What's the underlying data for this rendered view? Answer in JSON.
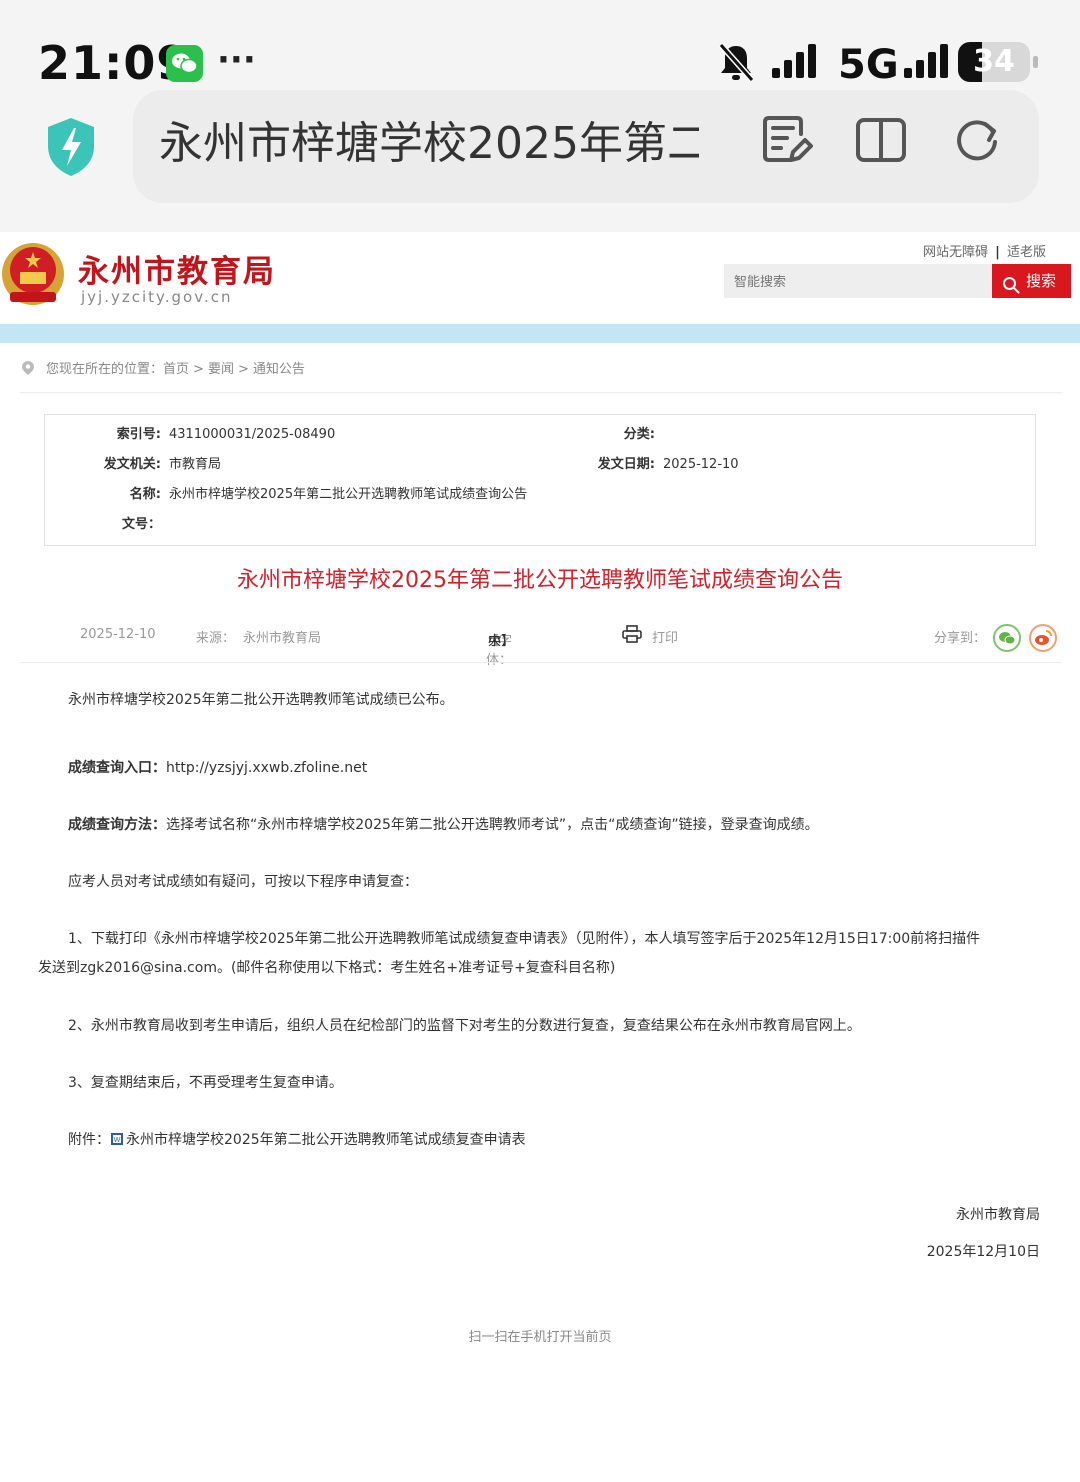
{
  "status_bar": {
    "time": "21:09",
    "network": "5G",
    "battery": "34",
    "battery_level_percent": 34,
    "icons": [
      "wechat-icon",
      "more-icon",
      "mute-bell-icon",
      "signal-icon",
      "signal-icon",
      "battery-icon"
    ]
  },
  "browser": {
    "url_title": "永州市梓塘学校2025年第二",
    "icons": [
      "shield-icon",
      "edit-note-icon",
      "reader-book-icon",
      "refresh-icon"
    ]
  },
  "site": {
    "name": "永州市教育局",
    "domain": "jyj.yzcity.gov.cn",
    "accessibility_link": "网站无障碍",
    "separator": "|",
    "elder_link": "适老版",
    "search_placeholder": "智能搜索",
    "search_button": "搜索"
  },
  "breadcrumb": {
    "prefix": "您现在所在的位置：",
    "items": [
      "首页",
      "要闻",
      "通知公告"
    ],
    "sep": ">"
  },
  "info": {
    "index_label": "索引号:",
    "index_value": "4311000031/2025-08490",
    "category_label": "分类:",
    "category_value": "",
    "issuer_label": "发文机关:",
    "issuer_value": "市教育局",
    "date_label": "发文日期:",
    "date_value": "2025-12-10",
    "name_label": "名称:",
    "name_value": "永州市梓塘学校2025年第二批公开选聘教师笔试成绩查询公告",
    "docno_label": "文号：",
    "docno_value": ""
  },
  "article": {
    "title": "永州市梓塘学校2025年第二批公开选聘教师笔试成绩查询公告",
    "date": "2025-12-10",
    "source_label": "来源：",
    "source": "永州市教育局",
    "font_label": "【字体：",
    "font_large": "大",
    "font_medium": "中",
    "font_small": "小】",
    "print": "打印",
    "share_label": "分享到：",
    "p1": "永州市梓塘学校2025年第二批公开选聘教师笔试成绩已公布。",
    "p2_label": "成绩查询入口：",
    "p2_value": "http://yzsjyj.xxwb.zfoline.net",
    "p3_label": "成绩查询方法：",
    "p3_value": "选择考试名称“永州市梓塘学校2025年第二批公开选聘教师考试”，点击“成绩查询”链接，登录查询成绩。",
    "p4": "应考人员对考试成绩如有疑问，可按以下程序申请复查：",
    "p5_line1": "1、下载打印《永州市梓塘学校2025年第二批公开选聘教师笔试成绩复查申请表》（见附件），本人填写签字后于2025年12月15日17:00前将扫描件",
    "p5_line2": "发送到zgk2016@sina.com。(邮件名称使用以下格式：考生姓名+准考证号+复查科目名称)",
    "p6": "2、永州市教育局收到考生申请后，组织人员在纪检部门的监督下对考生的分数进行复查，复查结果公布在永州市教育局官网上。",
    "p7": "3、复查期结束后，不再受理考生复查申请。",
    "attachment_label": "附件：",
    "attachment_name": "永州市梓塘学校2025年第二批公开选聘教师笔试成绩复查申请表",
    "signature": "永州市教育局",
    "signature_date": "2025年12月10日",
    "qr_hint": "扫一扫在手机打开当前页"
  },
  "colors": {
    "brand_red": "#d9171e",
    "title_red": "#d5202a",
    "band_blue": "#c3e6f7",
    "wechat_green": "#2bbf4c",
    "weibo_orange": "#f0843c"
  }
}
